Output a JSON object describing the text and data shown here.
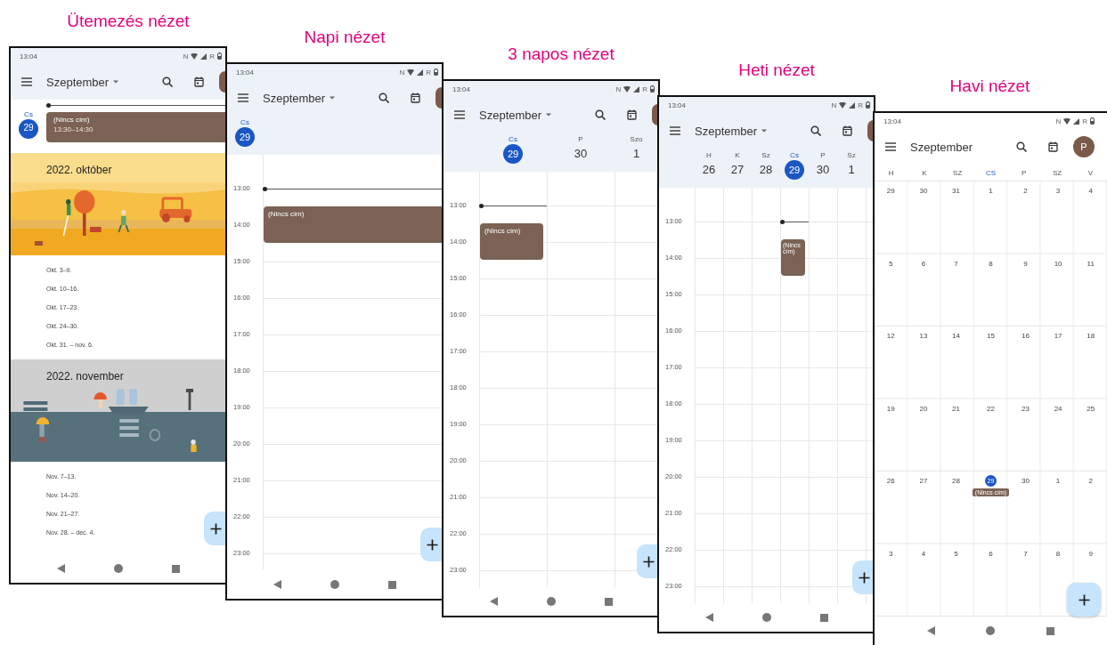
{
  "screens": [
    {
      "kind": "schedule",
      "caption": "Ütemezés nézet",
      "status": {
        "time": "13:04",
        "nfc": "N",
        "roaming": "R"
      },
      "title": "Szeptember",
      "dropdown": true,
      "today": {
        "weekday": "Cs",
        "day": "29"
      },
      "event": {
        "title": "(Nincs cím)",
        "time": "13:30–14:30"
      },
      "months": [
        {
          "title": "2022. október",
          "kind": "autumn",
          "weeks": [
            "Okt. 3–9.",
            "Okt. 10–16.",
            "Okt. 17–23.",
            "Okt. 24–30.",
            "Okt. 31. – nov. 6."
          ]
        },
        {
          "title": "2022. november",
          "kind": "rain",
          "weeks": [
            "Nov. 7–13.",
            "Nov. 14–20.",
            "Nov. 21–27.",
            "Nov. 28. – dec. 4."
          ]
        }
      ]
    },
    {
      "kind": "day",
      "caption": "Napi nézet",
      "status": {
        "time": "13:04",
        "nfc": "N",
        "roaming": "R"
      },
      "title": "Szeptember",
      "dropdown": true,
      "days": [
        {
          "weekday": "Cs",
          "day": "29",
          "selected": true
        }
      ],
      "hours": [
        "13:00",
        "14:00",
        "15:00",
        "16:00",
        "17:00",
        "18:00",
        "19:00",
        "20:00",
        "21:00",
        "22:00",
        "23:00"
      ],
      "event": {
        "title": "(Nincs cím)"
      }
    },
    {
      "kind": "three_day",
      "caption": "3 napos nézet",
      "status": {
        "time": "13:04",
        "nfc": "N",
        "roaming": "R"
      },
      "title": "Szeptember",
      "dropdown": true,
      "days": [
        {
          "weekday": "Cs",
          "day": "29",
          "selected": true
        },
        {
          "weekday": "P",
          "day": "30",
          "selected": false
        },
        {
          "weekday": "Szo",
          "day": "1",
          "selected": false
        }
      ],
      "hours": [
        "13:00",
        "14:00",
        "15:00",
        "16:00",
        "17:00",
        "18:00",
        "19:00",
        "20:00",
        "21:00",
        "22:00",
        "23:00"
      ],
      "event": {
        "title": "(Nincs cím)"
      }
    },
    {
      "kind": "week",
      "caption": "Heti nézet",
      "status": {
        "time": "13:04",
        "nfc": "N",
        "roaming": "R"
      },
      "title": "Szeptember",
      "dropdown": true,
      "days": [
        {
          "weekday": "H",
          "day": "26",
          "selected": false
        },
        {
          "weekday": "K",
          "day": "27",
          "selected": false
        },
        {
          "weekday": "Sz",
          "day": "28",
          "selected": false
        },
        {
          "weekday": "Cs",
          "day": "29",
          "selected": true
        },
        {
          "weekday": "P",
          "day": "30",
          "selected": false
        },
        {
          "weekday": "Sz",
          "day": "1",
          "selected": false
        }
      ],
      "hours": [
        "13:00",
        "14:00",
        "15:00",
        "16:00",
        "17:00",
        "18:00",
        "19:00",
        "20:00",
        "21:00",
        "22:00",
        "23:00"
      ],
      "event": {
        "title": "(Nincs cím)"
      }
    },
    {
      "kind": "month",
      "caption": "Havi nézet",
      "status": {
        "time": "13:04",
        "nfc": "N",
        "roaming": "R"
      },
      "title": "Szeptember",
      "dropdown": false,
      "avatar": "P",
      "weekdays": [
        {
          "label": "H",
          "selected": false
        },
        {
          "label": "K",
          "selected": false
        },
        {
          "label": "SZ",
          "selected": false
        },
        {
          "label": "CS",
          "selected": true
        },
        {
          "label": "P",
          "selected": false
        },
        {
          "label": "SZ",
          "selected": false
        },
        {
          "label": "V",
          "selected": false
        }
      ],
      "weeks": [
        [
          {
            "day": "29",
            "selected": false
          },
          {
            "day": "30",
            "selected": false
          },
          {
            "day": "31",
            "selected": false
          },
          {
            "day": "1",
            "selected": false
          },
          {
            "day": "2",
            "selected": false
          },
          {
            "day": "3",
            "selected": false
          },
          {
            "day": "4",
            "selected": false
          }
        ],
        [
          {
            "day": "5",
            "selected": false
          },
          {
            "day": "6",
            "selected": false
          },
          {
            "day": "7",
            "selected": false
          },
          {
            "day": "8",
            "selected": false
          },
          {
            "day": "9",
            "selected": false
          },
          {
            "day": "10",
            "selected": false
          },
          {
            "day": "11",
            "selected": false
          }
        ],
        [
          {
            "day": "12",
            "selected": false
          },
          {
            "day": "13",
            "selected": false
          },
          {
            "day": "14",
            "selected": false
          },
          {
            "day": "15",
            "selected": false
          },
          {
            "day": "16",
            "selected": false
          },
          {
            "day": "17",
            "selected": false
          },
          {
            "day": "18",
            "selected": false
          }
        ],
        [
          {
            "day": "19",
            "selected": false
          },
          {
            "day": "20",
            "selected": false
          },
          {
            "day": "21",
            "selected": false
          },
          {
            "day": "22",
            "selected": false
          },
          {
            "day": "23",
            "selected": false
          },
          {
            "day": "24",
            "selected": false
          },
          {
            "day": "25",
            "selected": false
          }
        ],
        [
          {
            "day": "26",
            "selected": false
          },
          {
            "day": "27",
            "selected": false
          },
          {
            "day": "28",
            "selected": false
          },
          {
            "day": "29",
            "selected": true,
            "event": "(Nincs cím)"
          },
          {
            "day": "30",
            "selected": false
          },
          {
            "day": "1",
            "selected": false
          },
          {
            "day": "2",
            "selected": false
          }
        ],
        [
          {
            "day": "3",
            "selected": false
          },
          {
            "day": "4",
            "selected": false
          },
          {
            "day": "5",
            "selected": false
          },
          {
            "day": "6",
            "selected": false
          },
          {
            "day": "7",
            "selected": false
          },
          {
            "day": "8",
            "selected": false
          },
          {
            "day": "9",
            "selected": false
          }
        ]
      ]
    }
  ]
}
